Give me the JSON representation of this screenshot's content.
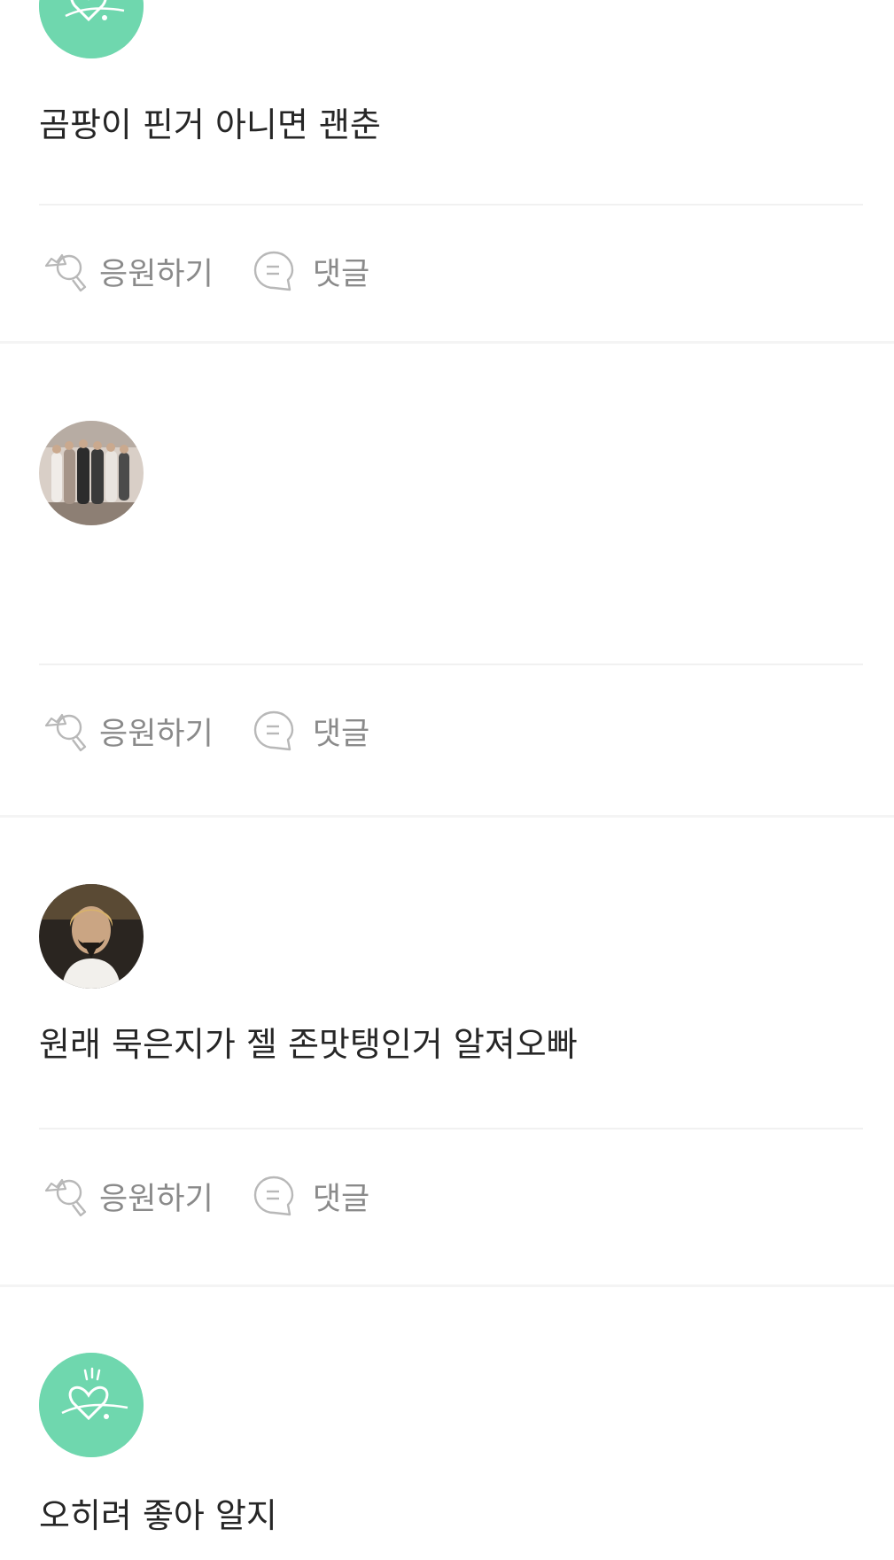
{
  "posts": [
    {
      "avatar": "mint-heart-logo-avatar",
      "text": "곰팡이 핀거 아니면 괜춘",
      "cheer_label": "응원하기",
      "comment_label": "댓글"
    },
    {
      "avatar": "group-photo-avatar",
      "text": "",
      "cheer_label": "응원하기",
      "comment_label": "댓글"
    },
    {
      "avatar": "portrait-photo-avatar",
      "text": "원래 묵은지가 젤 존맛탱인거 알져오빠",
      "cheer_label": "응원하기",
      "comment_label": "댓글"
    },
    {
      "avatar": "mint-heart-logo-avatar",
      "text": "오히려 좋아 알지",
      "cheer_label": "",
      "comment_label": ""
    }
  ],
  "colors": {
    "mint_avatar": "#6fd7ae",
    "action_text": "#8a8a8a",
    "post_text": "#262626",
    "divider": "#f1f1f1"
  },
  "icons": {
    "cheer": "lightstick-cheer-icon",
    "comment": "speech-bubble-icon"
  }
}
